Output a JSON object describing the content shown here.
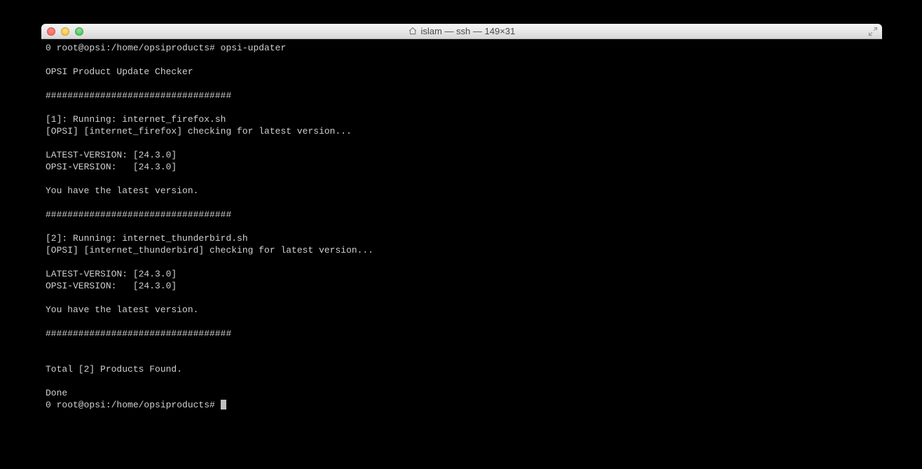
{
  "window": {
    "title": "islam — ssh — 149×31"
  },
  "terminal": {
    "line01": "0 root@opsi:/home/opsiproducts# opsi-updater",
    "line02": "",
    "line03": "OPSI Product Update Checker",
    "line04": "",
    "line05": "##################################",
    "line06": "",
    "line07": "[1]: Running: internet_firefox.sh",
    "line08": "[OPSI] [internet_firefox] checking for latest version...",
    "line09": "",
    "line10": "LATEST-VERSION: [24.3.0]",
    "line11": "OPSI-VERSION:   [24.3.0]",
    "line12": "",
    "line13": "You have the latest version.",
    "line14": "",
    "line15": "##################################",
    "line16": "",
    "line17": "[2]: Running: internet_thunderbird.sh",
    "line18": "[OPSI] [internet_thunderbird] checking for latest version...",
    "line19": "",
    "line20": "LATEST-VERSION: [24.3.0]",
    "line21": "OPSI-VERSION:   [24.3.0]",
    "line22": "",
    "line23": "You have the latest version.",
    "line24": "",
    "line25": "##################################",
    "line26": "",
    "line27": "",
    "line28": "Total [2] Products Found.",
    "line29": "",
    "line30": "Done",
    "line31": "0 root@opsi:/home/opsiproducts# "
  }
}
